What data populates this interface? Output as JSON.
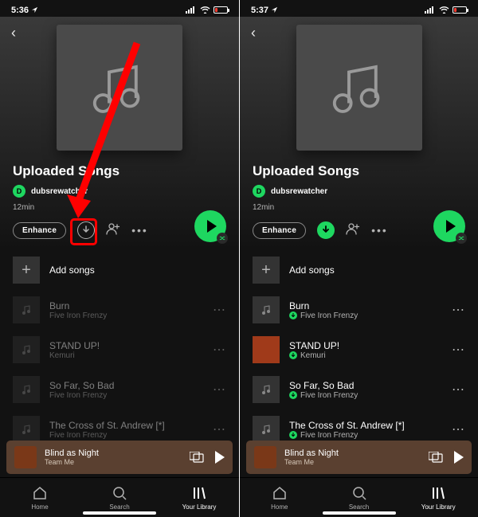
{
  "status": {
    "time_left": "5:36",
    "time_right": "5:37"
  },
  "playlist": {
    "title": "Uploaded Songs",
    "owner_initial": "D",
    "owner_name": "dubsrewatcher",
    "duration": "12min",
    "enhance_label": "Enhance",
    "add_songs_label": "Add songs"
  },
  "tracks": [
    {
      "title": "Burn",
      "artist": "Five Iron Frenzy"
    },
    {
      "title": "STAND UP!",
      "artist": "Kemuri"
    },
    {
      "title": "So Far, So Bad",
      "artist": "Five Iron Frenzy"
    },
    {
      "title": "The Cross of St. Andrew [*]",
      "artist": "Five Iron Frenzy"
    }
  ],
  "now_playing": {
    "title": "Blind as Night",
    "artist": "Team Me"
  },
  "tabs": {
    "home": "Home",
    "search": "Search",
    "library": "Your Library"
  }
}
